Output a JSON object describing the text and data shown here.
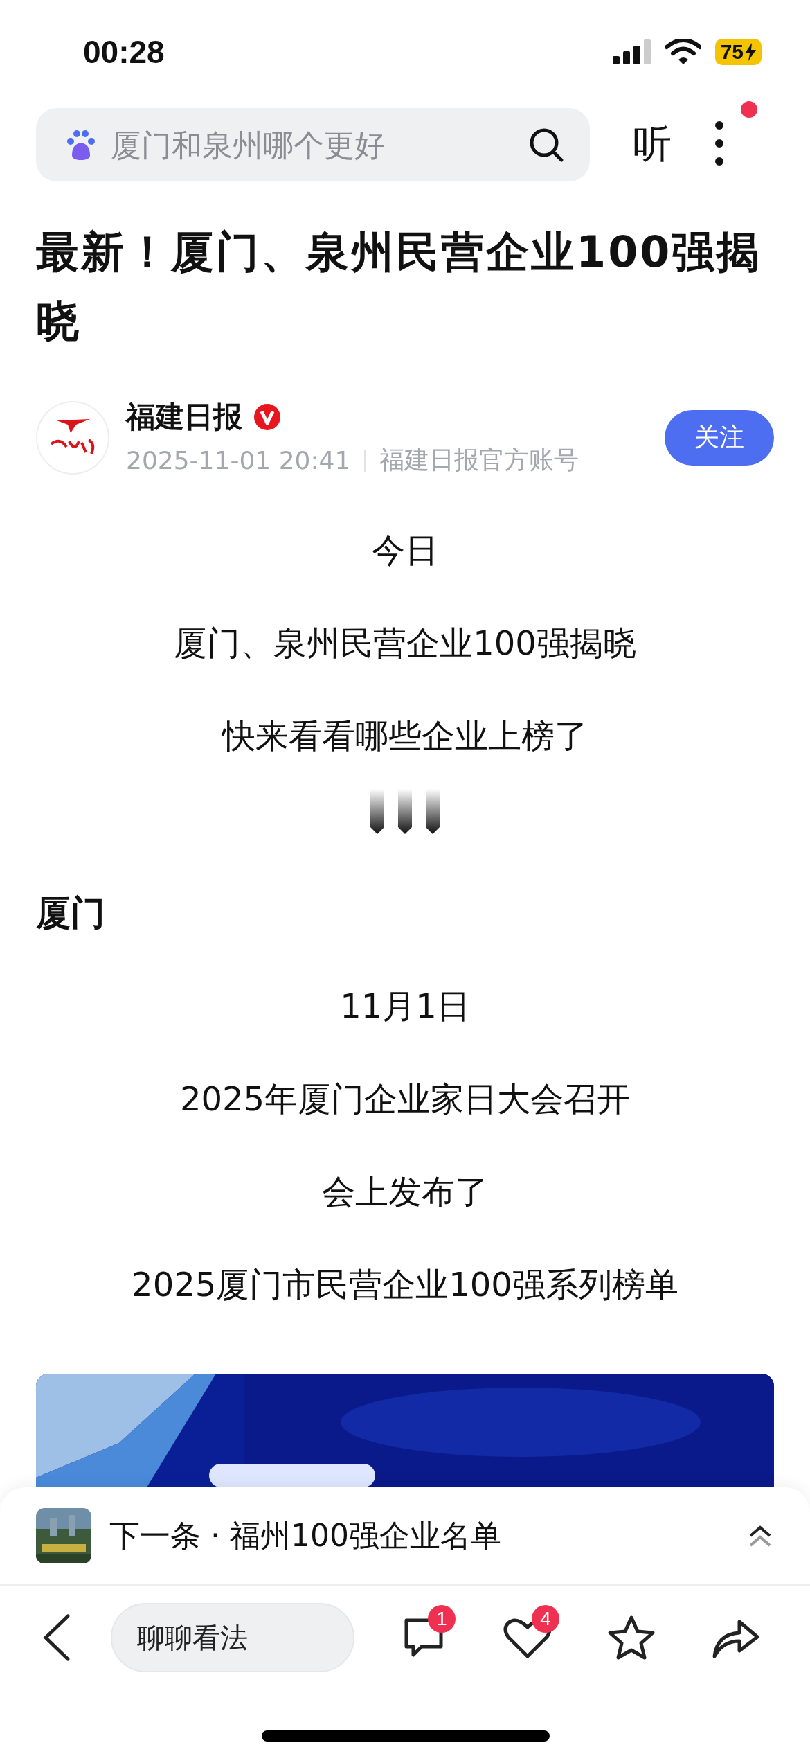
{
  "status_bar": {
    "time": "00:28",
    "battery": "75"
  },
  "search": {
    "placeholder": "厦门和泉州哪个更好"
  },
  "listen_button": "听",
  "menu": {
    "notification_dot": true
  },
  "article": {
    "title": "最新！厦门、泉州民营企业100强揭晓",
    "author": {
      "name": "福建日报",
      "verified": true,
      "date": "2025-11-01 20:41",
      "source": "福建日报官方账号"
    },
    "follow_button": "关注",
    "blocks": [
      {
        "kind": "center",
        "text": "今日"
      },
      {
        "kind": "center",
        "text": "厦门、泉州民营企业100强揭晓"
      },
      {
        "kind": "center",
        "text": "快来看看哪些企业上榜了"
      },
      {
        "kind": "arrows"
      },
      {
        "kind": "heading",
        "text": "厦门"
      },
      {
        "kind": "center",
        "text": "11月1日"
      },
      {
        "kind": "center",
        "text": "2025年厦门企业家日大会召开"
      },
      {
        "kind": "center",
        "text": "会上发布了"
      },
      {
        "kind": "center",
        "text": "2025厦门市民营企业100强系列榜单"
      },
      {
        "kind": "picture"
      }
    ]
  },
  "next_item": {
    "label": "下一条 · 福州100强企业名单"
  },
  "toolbar": {
    "comment_placeholder": "聊聊看法",
    "comment_count": "1",
    "like_count": "4"
  }
}
